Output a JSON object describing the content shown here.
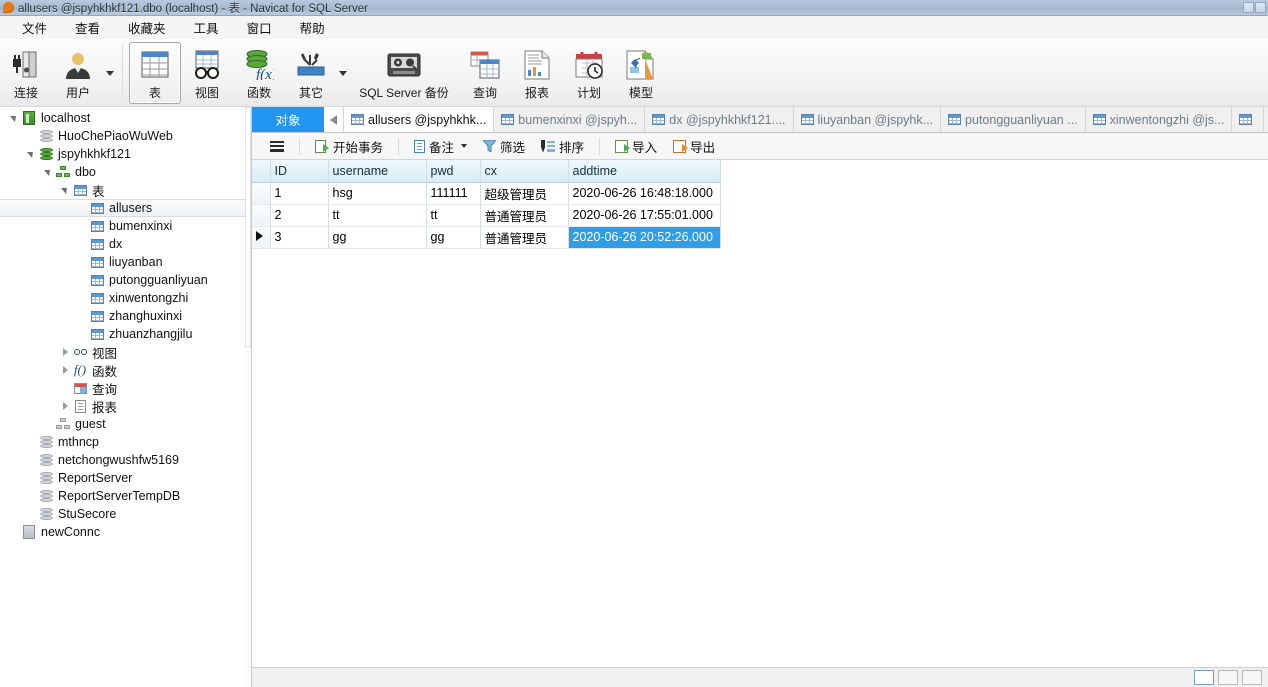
{
  "window": {
    "title": "allusers @jspyhkhkf121.dbo (localhost) - 表 - Navicat for SQL Server",
    "logo": "navicat-logo"
  },
  "menubar": {
    "items": [
      {
        "label": "文件",
        "name": "menu-file"
      },
      {
        "label": "查看",
        "name": "menu-view"
      },
      {
        "label": "收藏夹",
        "name": "menu-favorites"
      },
      {
        "label": "工具",
        "name": "menu-tools"
      },
      {
        "label": "窗口",
        "name": "menu-window"
      },
      {
        "label": "帮助",
        "name": "menu-help"
      }
    ]
  },
  "toolbar": {
    "items": [
      {
        "label": "连接",
        "icon": "connection-icon",
        "has_arrow": false,
        "selected": false
      },
      {
        "label": "用户",
        "icon": "user-icon",
        "has_arrow": true,
        "selected": false
      },
      {
        "label": "表",
        "icon": "table-icon",
        "has_arrow": false,
        "selected": true
      },
      {
        "label": "视图",
        "icon": "view-glasses-icon",
        "has_arrow": false,
        "selected": false
      },
      {
        "label": "函数",
        "icon": "function-fx-icon",
        "has_arrow": false,
        "selected": false
      },
      {
        "label": "其它",
        "icon": "other-tools-icon",
        "has_arrow": true,
        "selected": false
      },
      {
        "label": "SQL Server 备份",
        "icon": "backup-tape-icon",
        "has_arrow": false,
        "selected": false
      },
      {
        "label": "查询",
        "icon": "query-icon",
        "has_arrow": false,
        "selected": false
      },
      {
        "label": "报表",
        "icon": "report-icon",
        "has_arrow": false,
        "selected": false
      },
      {
        "label": "计划",
        "icon": "schedule-clock-icon",
        "has_arrow": false,
        "selected": false
      },
      {
        "label": "模型",
        "icon": "model-icon",
        "has_arrow": false,
        "selected": false
      }
    ]
  },
  "sidebar": {
    "tree": [
      {
        "label": "localhost",
        "icon": "server-icon",
        "indent": 0,
        "twisty": "expanded",
        "selected": false
      },
      {
        "label": "HuoChePiaoWuWeb",
        "icon": "database-grey-icon",
        "indent": 1,
        "twisty": "none",
        "selected": false
      },
      {
        "label": "jspyhkhkf121",
        "icon": "database-green-icon",
        "indent": 1,
        "twisty": "expanded",
        "selected": false
      },
      {
        "label": "dbo",
        "icon": "schema-icon",
        "indent": 2,
        "twisty": "expanded",
        "selected": false
      },
      {
        "label": "表",
        "icon": "table-icon",
        "indent": 3,
        "twisty": "expanded",
        "selected": false
      },
      {
        "label": "allusers",
        "icon": "table-icon",
        "indent": 4,
        "twisty": "none",
        "selected": true
      },
      {
        "label": "bumenxinxi",
        "icon": "table-icon",
        "indent": 4,
        "twisty": "none",
        "selected": false
      },
      {
        "label": "dx",
        "icon": "table-icon",
        "indent": 4,
        "twisty": "none",
        "selected": false
      },
      {
        "label": "liuyanban",
        "icon": "table-icon",
        "indent": 4,
        "twisty": "none",
        "selected": false
      },
      {
        "label": "putongguanliyuan",
        "icon": "table-icon",
        "indent": 4,
        "twisty": "none",
        "selected": false
      },
      {
        "label": "xinwentongzhi",
        "icon": "table-icon",
        "indent": 4,
        "twisty": "none",
        "selected": false
      },
      {
        "label": "zhanghuxinxi",
        "icon": "table-icon",
        "indent": 4,
        "twisty": "none",
        "selected": false
      },
      {
        "label": "zhuanzhangjilu",
        "icon": "table-icon",
        "indent": 4,
        "twisty": "none",
        "selected": false
      },
      {
        "label": "视图",
        "icon": "view-glasses-icon",
        "indent": 3,
        "twisty": "collapsed",
        "selected": false
      },
      {
        "label": "函数",
        "icon": "function-fx-icon",
        "indent": 3,
        "twisty": "collapsed",
        "selected": false
      },
      {
        "label": "查询",
        "icon": "query-icon",
        "indent": 3,
        "twisty": "none",
        "selected": false
      },
      {
        "label": "报表",
        "icon": "report-icon",
        "indent": 3,
        "twisty": "collapsed",
        "selected": false
      },
      {
        "label": "guest",
        "icon": "schema-grey-icon",
        "indent": 2,
        "twisty": "none",
        "selected": false
      },
      {
        "label": "mthncp",
        "icon": "database-grey-icon",
        "indent": 1,
        "twisty": "none",
        "selected": false
      },
      {
        "label": "netchongwushfw5169",
        "icon": "database-grey-icon",
        "indent": 1,
        "twisty": "none",
        "selected": false
      },
      {
        "label": "ReportServer",
        "icon": "database-grey-icon",
        "indent": 1,
        "twisty": "none",
        "selected": false
      },
      {
        "label": "ReportServerTempDB",
        "icon": "database-grey-icon",
        "indent": 1,
        "twisty": "none",
        "selected": false
      },
      {
        "label": "StuSecore",
        "icon": "database-grey-icon",
        "indent": 1,
        "twisty": "none",
        "selected": false
      },
      {
        "label": "newConnc",
        "icon": "connection-grey-icon",
        "indent": 0,
        "twisty": "none",
        "selected": false
      }
    ]
  },
  "tabstrip": {
    "object_tab": "对象",
    "scroll_left_icon": "chevron-left-icon",
    "tabs": [
      {
        "label": "allusers @jspyhkhk...",
        "active": true
      },
      {
        "label": "bumenxinxi @jspyh...",
        "active": false
      },
      {
        "label": "dx @jspyhkhkf121....",
        "active": false
      },
      {
        "label": "liuyanban @jspyhk...",
        "active": false
      },
      {
        "label": "putongguanliyuan ...",
        "active": false
      },
      {
        "label": "xinwentongzhi @js...",
        "active": false
      },
      {
        "label": "",
        "active": false
      }
    ]
  },
  "grid_toolbar": {
    "menu_icon": "hamburger-icon",
    "buttons": [
      {
        "label": "开始事务",
        "icon": "begin-transaction-icon",
        "has_arrow": false
      },
      {
        "label": "备注",
        "icon": "note-icon",
        "has_arrow": true
      },
      {
        "label": "筛选",
        "icon": "filter-icon",
        "has_arrow": false
      },
      {
        "label": "排序",
        "icon": "sort-icon",
        "has_arrow": false
      },
      {
        "label": "导入",
        "icon": "import-icon",
        "has_arrow": false
      },
      {
        "label": "导出",
        "icon": "export-icon",
        "has_arrow": false
      }
    ]
  },
  "table_data": {
    "columns": [
      "ID",
      "username",
      "pwd",
      "cx",
      "addtime"
    ],
    "rows": [
      {
        "marker": false,
        "ID": "1",
        "username": "hsg",
        "pwd": "111111",
        "cx": "超级管理员",
        "addtime": "2020-06-26 16:48:18.000"
      },
      {
        "marker": false,
        "ID": "2",
        "username": "tt",
        "pwd": "tt",
        "cx": "普通管理员",
        "addtime": "2020-06-26 17:55:01.000"
      },
      {
        "marker": true,
        "ID": "3",
        "username": "gg",
        "pwd": "gg",
        "cx": "普通管理员",
        "addtime": "2020-06-26 20:52:26.000"
      }
    ],
    "selected_cell": {
      "row": 2,
      "column": "addtime"
    }
  },
  "colors": {
    "accent": "#2196f3",
    "selection": "#2e9ee8",
    "header": "#d7ecf7",
    "titlebar": "#a9bdd4"
  }
}
